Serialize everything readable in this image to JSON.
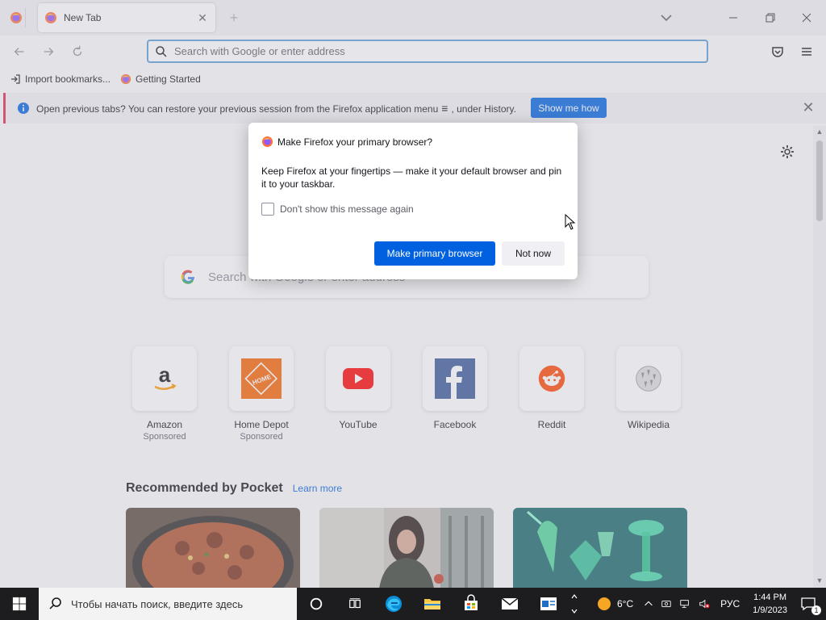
{
  "tabbar": {
    "tab_title": "New Tab",
    "close_glyph": "✕",
    "new_tab_glyph": "+"
  },
  "navbar": {
    "url_placeholder": "Search with Google or enter address"
  },
  "bookmarks": {
    "items": [
      {
        "label": "Import bookmarks...",
        "icon": "import-icon"
      },
      {
        "label": "Getting Started",
        "icon": "firefox-icon"
      }
    ]
  },
  "infobar": {
    "message_part1": "Open previous tabs? You can restore your previous session from the Firefox application menu",
    "menu_glyph": "≡",
    "message_part2": ", under History.",
    "button_label": "Show me how",
    "close_glyph": "✕"
  },
  "newtab": {
    "search_placeholder": "Search with Google or enter address",
    "tiles": [
      {
        "label": "Amazon",
        "sponsored": "Sponsored",
        "icon": "amazon-icon"
      },
      {
        "label": "Home Depot",
        "sponsored": "Sponsored",
        "icon": "home-depot-icon"
      },
      {
        "label": "YouTube",
        "sponsored": "",
        "icon": "youtube-icon"
      },
      {
        "label": "Facebook",
        "sponsored": "",
        "icon": "facebook-icon"
      },
      {
        "label": "Reddit",
        "sponsored": "",
        "icon": "reddit-icon"
      },
      {
        "label": "Wikipedia",
        "sponsored": "",
        "icon": "wikipedia-icon"
      }
    ],
    "pocket_title": "Recommended by Pocket",
    "pocket_learn_more": "Learn more"
  },
  "dialog": {
    "title": "Make Firefox your primary browser?",
    "body": "Keep Firefox at your fingertips — make it your default browser and pin it to your taskbar.",
    "checkbox_label": "Don't show this message again",
    "primary_button": "Make primary browser",
    "secondary_button": "Not now"
  },
  "taskbar": {
    "search_placeholder": "Чтобы начать поиск, введите здесь",
    "weather_temp": "6°C",
    "language": "РУС",
    "time": "1:44 PM",
    "date": "1/9/2023",
    "notification_count": "1"
  },
  "colors": {
    "accent": "#0061e0",
    "infobar_stripe": "#e22850",
    "taskbar": "#1d1d1f"
  }
}
